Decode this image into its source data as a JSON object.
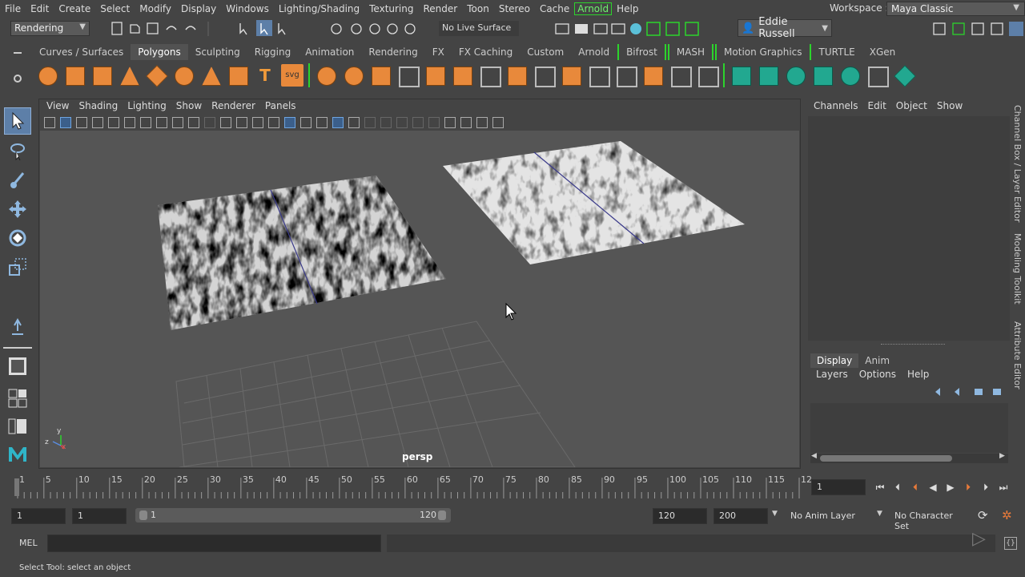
{
  "menubar": {
    "items": [
      "File",
      "Edit",
      "Create",
      "Select",
      "Modify",
      "Display",
      "Windows",
      "Lighting/Shading",
      "Texturing",
      "Render",
      "Toon",
      "Stereo",
      "Cache"
    ],
    "arnold": "Arnold",
    "help": "Help"
  },
  "workspace": {
    "label": "Workspace :",
    "value": "Maya Classic"
  },
  "statusline": {
    "mode": "Rendering",
    "live_surface": "No Live Surface",
    "user": "Eddie Russell"
  },
  "shelf": {
    "tabs": [
      "Curves / Surfaces",
      "Polygons",
      "Sculpting",
      "Rigging",
      "Animation",
      "Rendering",
      "FX",
      "FX Caching",
      "Custom",
      "Arnold",
      "Bifrost",
      "MASH",
      "Motion Graphics",
      "TURTLE",
      "XGen"
    ],
    "active_tab": "Polygons",
    "text_icon": "T",
    "svg_icon": "svg"
  },
  "viewport": {
    "menu": [
      "View",
      "Shading",
      "Lighting",
      "Show",
      "Renderer",
      "Panels"
    ],
    "camera": "persp",
    "axis_labels": [
      "y",
      "z",
      "x"
    ]
  },
  "channel_box": {
    "menu": [
      "Channels",
      "Edit",
      "Object",
      "Show"
    ]
  },
  "side_tabs": [
    "Channel Box / Layer Editor",
    "Modeling Toolkit",
    "Attribute Editor"
  ],
  "layer_editor": {
    "tabs": [
      "Display",
      "Anim"
    ],
    "active_tab": "Display",
    "menu": [
      "Layers",
      "Options",
      "Help"
    ]
  },
  "timeline": {
    "ticks": [
      "1",
      "5",
      "10",
      "15",
      "20",
      "25",
      "30",
      "35",
      "40",
      "45",
      "50",
      "55",
      "60",
      "65",
      "70",
      "75",
      "80",
      "85",
      "90",
      "95",
      "100",
      "105",
      "110",
      "115",
      "12"
    ],
    "current_frame": "1"
  },
  "range": {
    "start": "1",
    "playback_start": "1",
    "slider_start": "1",
    "slider_end": "120",
    "playback_end": "120",
    "end": "200",
    "anim_layer": "No Anim Layer",
    "character_set": "No Character Set"
  },
  "command_line": {
    "language": "MEL",
    "help_text": "Select Tool: select an object"
  },
  "icons": {
    "select_tool": "arrow-icon",
    "lasso_tool": "lasso-icon",
    "paint_tool": "brush-icon",
    "move_tool": "move-icon",
    "rotate_tool": "rotate-icon",
    "scale_tool": "scale-icon",
    "maya_logo": "maya-logo-icon"
  }
}
